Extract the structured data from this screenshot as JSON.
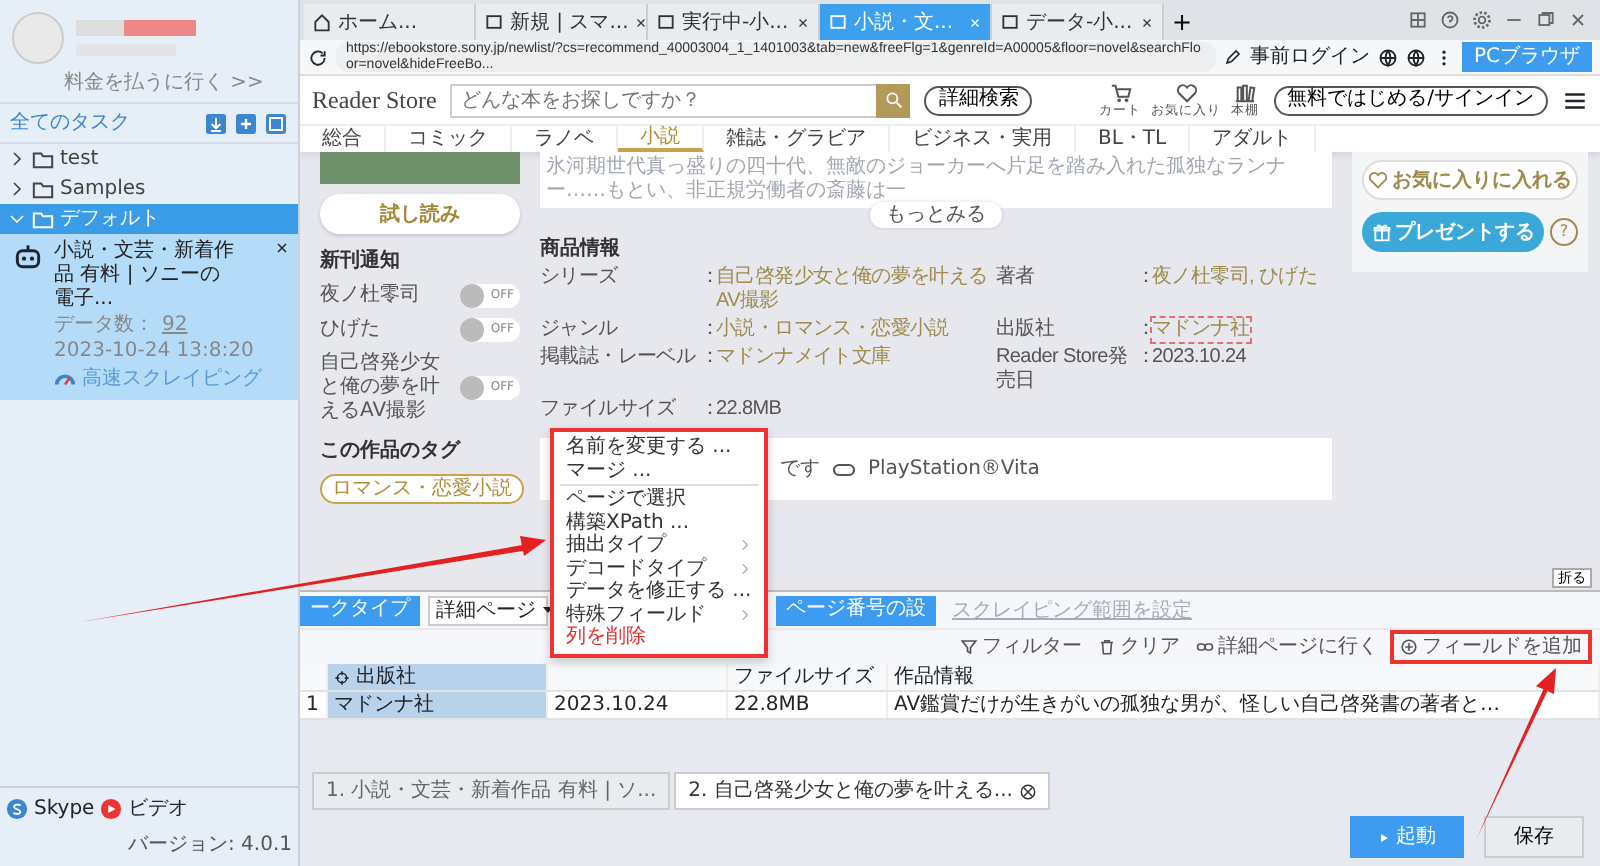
{
  "sidebar": {
    "pay_link": "料金を払うに行く >>",
    "tasks_label": "全てのタスク",
    "tree": [
      {
        "label": "test",
        "expanded": false,
        "selected": false
      },
      {
        "label": "Samples",
        "expanded": false,
        "selected": false
      },
      {
        "label": "デフォルト",
        "expanded": true,
        "selected": true,
        "children": [
          {
            "title": "小説・文芸・新着作品 有料 | ソニーの電子...",
            "count_label": "データ数：",
            "count": "92",
            "time": "2023-10-24 13:8:20",
            "mode": "高速スクレイピング"
          }
        ]
      }
    ],
    "footer": {
      "skype": "Skype",
      "video": "ビデオ",
      "version": "バージョン: 4.0.1"
    }
  },
  "browser_tabs": [
    {
      "label": "ホーム...",
      "kind": "home",
      "selected": false
    },
    {
      "label": "新規 | スマ...",
      "kind": "page",
      "selected": false
    },
    {
      "label": "実行中-小...",
      "kind": "page",
      "selected": false
    },
    {
      "label": "小説・文...",
      "kind": "page",
      "selected": true
    },
    {
      "label": "データ-小...",
      "kind": "page",
      "selected": false
    }
  ],
  "new_tab": "+",
  "address_bar": {
    "url": "https://ebookstore.sony.jp/newlist/?cs=recommend_40003004_1_1401003&tab=new&freeFlg=1&genreId=A00005&floor=novel&searchFloor=novel&hideFreeBo...",
    "pre_login": "事前ログイン",
    "browser_mode": "PCブラウザ"
  },
  "store": {
    "logo": "Reader Store",
    "search_placeholder": "どんな本をお探しですか？",
    "advanced_search": "詳細検索",
    "header_icons": [
      {
        "label": "カート",
        "kind": "cart"
      },
      {
        "label": "お気に入り",
        "kind": "heart"
      },
      {
        "label": "本棚",
        "kind": "shelf"
      }
    ],
    "signin": "無料ではじめる/サインイン",
    "nav": [
      {
        "label": "総合",
        "selected": false
      },
      {
        "label": "コミック",
        "selected": false
      },
      {
        "label": "ラノベ",
        "selected": false
      },
      {
        "label": "小説",
        "selected": true
      },
      {
        "label": "雑誌・グラビア",
        "selected": false
      },
      {
        "label": "ビジネス・実用",
        "selected": false
      },
      {
        "label": "BL・TL",
        "selected": false
      },
      {
        "label": "アダルト",
        "selected": false
      }
    ],
    "trial_button": "試し読み",
    "notify_title": "新刊通知",
    "notify": [
      {
        "label": "夜ノ杜零司",
        "state": "OFF",
        "on": false
      },
      {
        "label": "ひげた",
        "state": "OFF",
        "on": false
      },
      {
        "label": "自己啓発少女と俺の夢を叶えるAV撮影",
        "state": "OFF",
        "on": false
      }
    ],
    "tags_title": "この作品のタグ",
    "tags": [
      "ロマンス・恋愛小説"
    ],
    "description": "氷河期世代真っ盛りの四十代、無敵のジョーカーへ片足を踏み入れた孤独なランナー……もとい、非正規労働者の斎藤は一",
    "more": "もっとみる",
    "info_title": "商品情報",
    "info": [
      {
        "label": "シリーズ",
        "colon": "：",
        "value": "自己啓発少女と俺の夢を叶えるAV撮影",
        "kind": "link"
      },
      {
        "label": "著者",
        "colon": "：",
        "value": "夜ノ杜零司, ひげた",
        "kind": "link"
      },
      {
        "label": "ジャンル",
        "colon": "：",
        "value": "小説・ロマンス・恋愛小説",
        "kind": "link"
      },
      {
        "label": "出版社",
        "colon": "：",
        "value": "マドンナ社",
        "kind": "marked"
      },
      {
        "label": "掲載誌・レーベル",
        "colon": "：",
        "value": "マドンナメイト文庫",
        "kind": "link"
      },
      {
        "label": "Reader Store発売日",
        "colon": "：",
        "value": "2023.10.24",
        "kind": "plain"
      },
      {
        "label": "ファイルサイズ",
        "colon": "：",
        "value": "22.8MB",
        "kind": "plain"
      }
    ],
    "devices_note": "です",
    "device": "PlayStation®Vita",
    "favorite": "お気に入りに入れる",
    "present": "プレゼントする",
    "help": "?"
  },
  "context_menu": [
    {
      "label": "名前を変更する ...",
      "kind": "item"
    },
    {
      "label": "マージ ...",
      "kind": "item"
    },
    {
      "kind": "divider"
    },
    {
      "label": "ページで選択",
      "kind": "item"
    },
    {
      "label": "構築XPath ...",
      "kind": "item"
    },
    {
      "label": "抽出タイプ",
      "kind": "submenu"
    },
    {
      "label": "デコードタイプ",
      "kind": "submenu"
    },
    {
      "label": "データを修正する ...",
      "kind": "item"
    },
    {
      "label": "特殊フィールド",
      "kind": "submenu"
    },
    {
      "label": "列を削除",
      "kind": "danger"
    }
  ],
  "data_panel": {
    "collapse": "折る",
    "type_button": "ークタイプ",
    "page_select": "詳細ページ",
    "page_number_button": "ページ番号の設",
    "range_link": "スクレイピング範囲を設定",
    "actions": [
      {
        "label": "フィルター",
        "kind": "filter"
      },
      {
        "label": "クリア",
        "kind": "trash"
      },
      {
        "label": "詳細ページに行く",
        "kind": "link"
      },
      {
        "label": "フィールドを追加",
        "kind": "add"
      }
    ],
    "columns": [
      "出版社",
      "",
      "ファイルサイズ",
      "作品情報"
    ],
    "rows": [
      {
        "index": "1",
        "cells": [
          "マドンナ社",
          "2023.10.24",
          "22.8MB",
          "AV鑑賞だけが生きがいの孤独な男が、怪しい自己啓発書の著者と…"
        ]
      }
    ],
    "tabs": [
      {
        "label": "1. 小説・文芸・新着作品 有料 | ソ...",
        "selected": false
      },
      {
        "label": "2. 自己啓発少女と俺の夢を叶える...",
        "selected": true
      }
    ],
    "start": "起動",
    "save": "保存"
  }
}
